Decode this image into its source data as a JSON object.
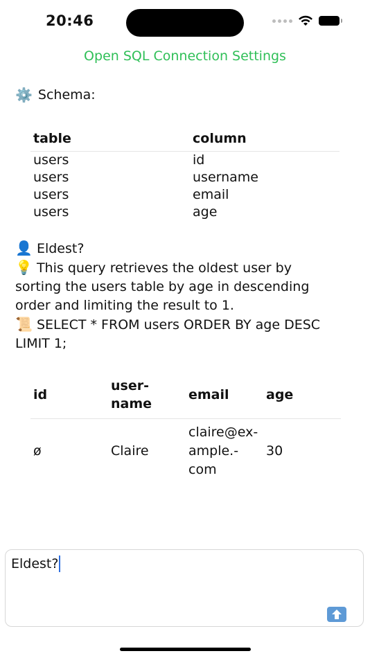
{
  "status_bar": {
    "time": "20:46"
  },
  "settings_link": "Open SQL Connection Settings",
  "schema": {
    "icon": "⚙️",
    "label": "Schema:",
    "headers": [
      "table",
      "column"
    ],
    "rows": [
      [
        "users",
        "id"
      ],
      [
        "users",
        "username"
      ],
      [
        "users",
        "email"
      ],
      [
        "users",
        "age"
      ]
    ]
  },
  "chat": {
    "question_icon": "👤",
    "question": "Eldest?",
    "explanation_icon": "💡",
    "explanation": "This query retrieves the oldest user by sorting the users table by age in descending order and limiting the result to 1.",
    "sql_icon": "📜",
    "sql": "SELECT * FROM users ORDER BY age DESC LIMIT 1;"
  },
  "result": {
    "headers": [
      "id",
      "user-name",
      "email",
      "age"
    ],
    "rows": [
      [
        "ø",
        "Claire",
        "claire@ex­ample.­com",
        "30"
      ]
    ]
  },
  "input": {
    "value": "Eldest?"
  },
  "colors": {
    "accent_green": "#2fbf57",
    "send_button": "#5e9ad6"
  }
}
